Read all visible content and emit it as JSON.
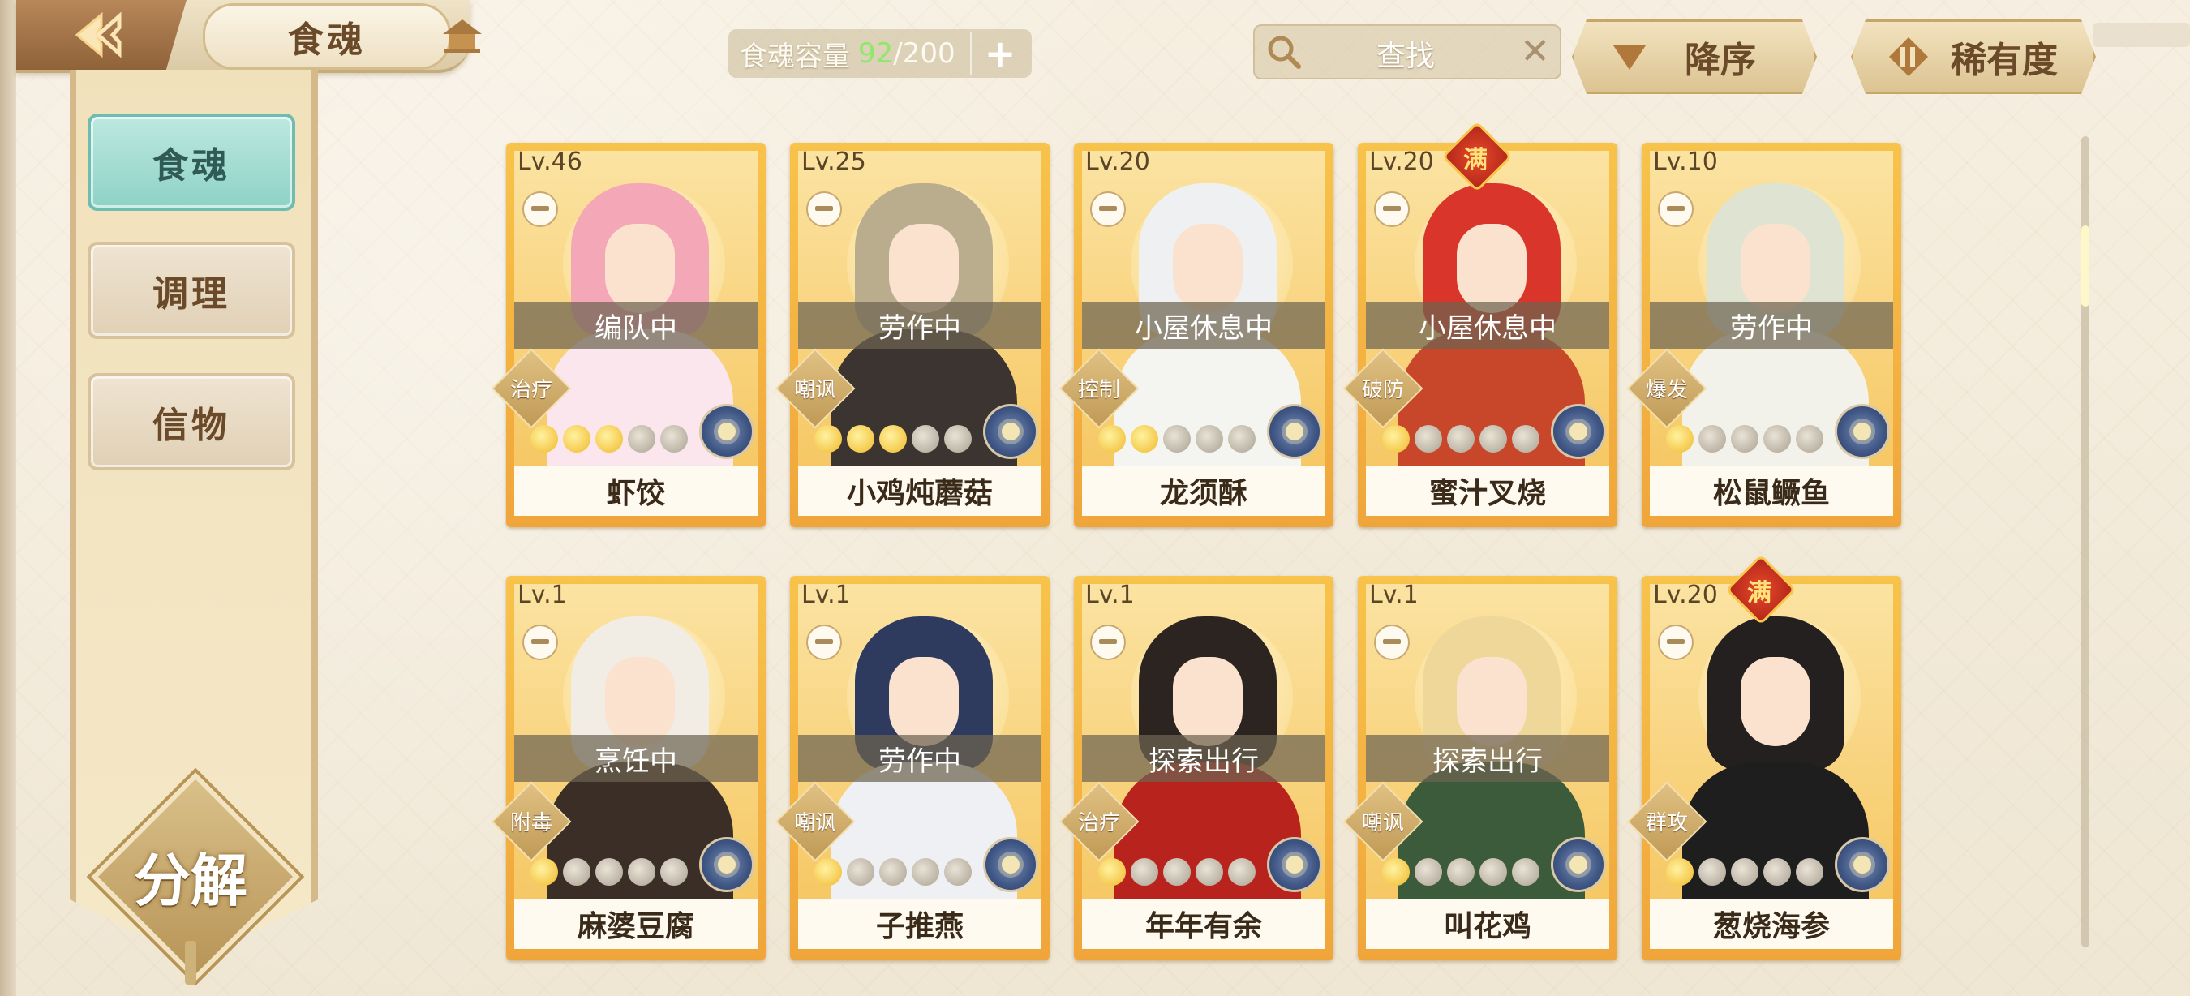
{
  "header": {
    "tab_title": "食魂",
    "capacity_label": "食魂容量",
    "capacity_current": "92",
    "capacity_max": "/200",
    "capacity_add": "+",
    "search_placeholder": "查找",
    "search_clear": "✕",
    "sort_order_label": "降序",
    "sort_field_label": "稀有度"
  },
  "sidebar": {
    "tabs": [
      {
        "label": "食魂",
        "active": true
      },
      {
        "label": "调理",
        "active": false
      },
      {
        "label": "信物",
        "active": false
      }
    ],
    "decompose_label": "分解"
  },
  "cards": [
    {
      "level": "Lv.46",
      "status": "编队中",
      "role": "治疗",
      "name": "虾饺",
      "stars_on": 3,
      "stars_total": 5,
      "max": false,
      "hair": "#f3a7b7",
      "body": "#fbe6ee"
    },
    {
      "level": "Lv.25",
      "status": "劳作中",
      "role": "嘲讽",
      "name": "小鸡炖蘑菇",
      "stars_on": 3,
      "stars_total": 5,
      "max": false,
      "hair": "#b9ad8e",
      "body": "#3b3430"
    },
    {
      "level": "Lv.20",
      "status": "小屋休息中",
      "role": "控制",
      "name": "龙须酥",
      "stars_on": 2,
      "stars_total": 5,
      "max": false,
      "hair": "#eef0f2",
      "body": "#f4f4f0"
    },
    {
      "level": "Lv.20",
      "status": "小屋休息中",
      "role": "破防",
      "name": "蜜汁叉烧",
      "stars_on": 1,
      "stars_total": 5,
      "max": true,
      "max_label": "满",
      "hair": "#d9352a",
      "body": "#c8462a"
    },
    {
      "level": "Lv.10",
      "status": "劳作中",
      "role": "爆发",
      "name": "松鼠鳜鱼",
      "stars_on": 1,
      "stars_total": 5,
      "max": false,
      "hair": "#dfe3d2",
      "body": "#f2f1ea"
    },
    {
      "level": "Lv.1",
      "status": "烹饪中",
      "role": "附毒",
      "name": "麻婆豆腐",
      "stars_on": 1,
      "stars_total": 5,
      "max": false,
      "hair": "#f1ede4",
      "body": "#3a2e26"
    },
    {
      "level": "Lv.1",
      "status": "劳作中",
      "role": "嘲讽",
      "name": "子推燕",
      "stars_on": 1,
      "stars_total": 5,
      "max": false,
      "hair": "#2e3a5e",
      "body": "#eef0f4"
    },
    {
      "level": "Lv.1",
      "status": "探索出行",
      "role": "治疗",
      "name": "年年有余",
      "stars_on": 1,
      "stars_total": 5,
      "max": false,
      "hair": "#2b2420",
      "body": "#b9231d"
    },
    {
      "level": "Lv.1",
      "status": "探索出行",
      "role": "嘲讽",
      "name": "叫花鸡",
      "stars_on": 1,
      "stars_total": 5,
      "max": false,
      "hair": "#efd79a",
      "body": "#3c5b3a"
    },
    {
      "level": "Lv.20",
      "status": "",
      "role": "群攻",
      "name": "葱烧海参",
      "stars_on": 1,
      "stars_total": 5,
      "max": true,
      "max_label": "满",
      "hair": "#242020",
      "body": "#1e1e1e"
    }
  ],
  "colors": {
    "accent_teal": "#8ed2c6",
    "card_gold": "#f0a53a",
    "capacity_green": "#8ee86a"
  },
  "icons": [
    "back-arrow-icon",
    "home-icon",
    "search-icon",
    "clear-icon",
    "sort-desc-icon",
    "rarity-sort-icon",
    "lock-icon",
    "element-icon",
    "star-icon"
  ]
}
